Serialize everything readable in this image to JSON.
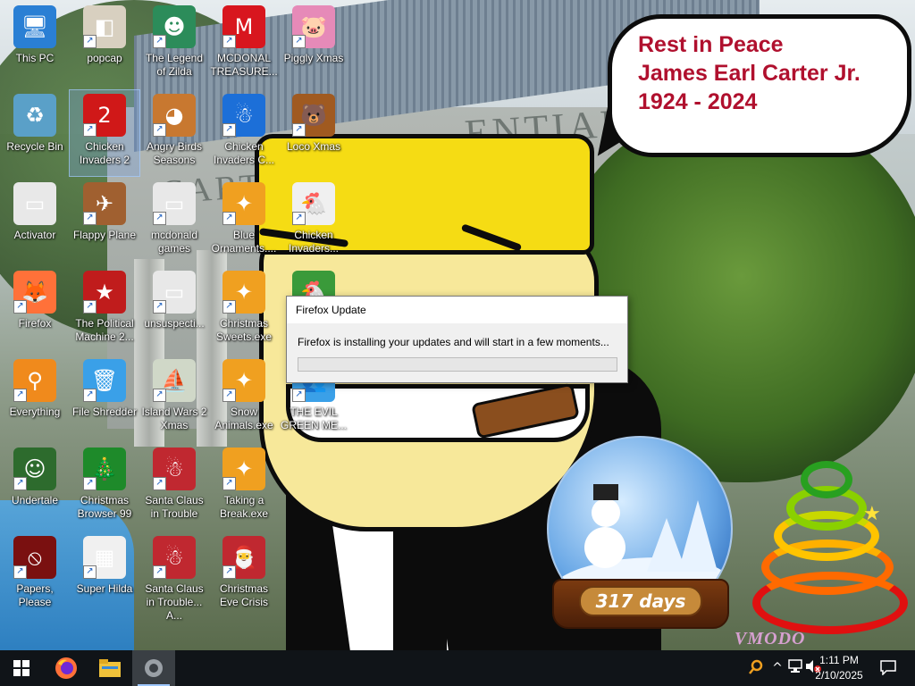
{
  "wallpaper": {
    "building_text": "ENTIAL",
    "building_text2": "CART",
    "speech_bubble": {
      "line1": "Rest in Peace",
      "line2": "James Earl Carter Jr.",
      "line3": "1924 - 2024"
    },
    "snow_globe_days": "317 days",
    "signature": "VMODO"
  },
  "desktop_icons": [
    {
      "label": "This PC",
      "icon": "computer-icon",
      "color": "#2a7fd4",
      "glyph": "🖥"
    },
    {
      "label": "Recycle Bin",
      "icon": "recycle-bin-icon",
      "color": "#5aa0c8",
      "glyph": "♻"
    },
    {
      "label": "Activator",
      "icon": "activator-icon",
      "color": "#e8e8e8",
      "glyph": "▭"
    },
    {
      "label": "Firefox",
      "icon": "firefox-icon",
      "color": "#ff7139",
      "glyph": "🦊"
    },
    {
      "label": "Everything",
      "icon": "everything-icon",
      "color": "#f08a1c",
      "glyph": "⚲"
    },
    {
      "label": "Undertale",
      "icon": "undertale-icon",
      "color": "#2d6b2d",
      "glyph": "☺"
    },
    {
      "label": "Papers, Please",
      "icon": "papers-please-icon",
      "color": "#7a1010",
      "glyph": "⦸"
    },
    {
      "label": "popcap",
      "icon": "popcap-icon",
      "color": "#d8d0c0",
      "glyph": "◧"
    },
    {
      "label": "Chicken Invaders 2",
      "icon": "chicken-invaders-2-icon",
      "color": "#d01818",
      "glyph": "2"
    },
    {
      "label": "Flappy Plane",
      "icon": "flappy-plane-icon",
      "color": "#a06030",
      "glyph": "✈"
    },
    {
      "label": "The Political Machine 2...",
      "icon": "political-machine-icon",
      "color": "#c01c1c",
      "glyph": "★"
    },
    {
      "label": "File Shredder",
      "icon": "file-shredder-icon",
      "color": "#3aa0e8",
      "glyph": "🗑"
    },
    {
      "label": "Christmas Browser 99",
      "icon": "christmas-browser-icon",
      "color": "#1e8a2a",
      "glyph": "🎄"
    },
    {
      "label": "Super Hilda",
      "icon": "super-hilda-icon",
      "color": "#f0f0f0",
      "glyph": "▦"
    },
    {
      "label": "The Legend of Zilda",
      "icon": "legend-of-zilda-icon",
      "color": "#2c8c5a",
      "glyph": "☻"
    },
    {
      "label": "Angry Birds Seasons",
      "icon": "angry-birds-seasons-icon",
      "color": "#c87830",
      "glyph": "◕"
    },
    {
      "label": "mcdonald games",
      "icon": "mcdonald-games-icon",
      "color": "#e8e8e8",
      "glyph": "▭"
    },
    {
      "label": "unsuspecti...",
      "icon": "unsuspecting-icon",
      "color": "#e8e8e8",
      "glyph": "▭"
    },
    {
      "label": "Island Wars 2 Xmas",
      "icon": "island-wars-icon",
      "color": "#d0d8c8",
      "glyph": "⛵"
    },
    {
      "label": "Santa Claus in Trouble",
      "icon": "santa-claus-trouble-icon",
      "color": "#c02830",
      "glyph": "☃"
    },
    {
      "label": "Santa Claus in Trouble... A...",
      "icon": "santa-claus-trouble-2-icon",
      "color": "#c02830",
      "glyph": "☃"
    },
    {
      "label": "MCDONAL TREASURE...",
      "icon": "mcdonald-treasure-icon",
      "color": "#d8161e",
      "glyph": "M"
    },
    {
      "label": "Chicken Invaders C...",
      "icon": "chicken-invaders-c-icon",
      "color": "#1c6fd8",
      "glyph": "☃"
    },
    {
      "label": "Blue Ornaments....",
      "icon": "blue-ornaments-icon",
      "color": "#f0a020",
      "glyph": "✦"
    },
    {
      "label": "Christmas Sweets.exe",
      "icon": "christmas-sweets-icon",
      "color": "#f0a020",
      "glyph": "✦"
    },
    {
      "label": "Snow Animals.exe",
      "icon": "snow-animals-icon",
      "color": "#f0a020",
      "glyph": "✦"
    },
    {
      "label": "Taking a Break.exe",
      "icon": "taking-a-break-icon",
      "color": "#f0a020",
      "glyph": "✦"
    },
    {
      "label": "Christmas Eve Crisis",
      "icon": "christmas-eve-crisis-icon",
      "color": "#c02830",
      "glyph": "🎅"
    },
    {
      "label": "Piggly Xmas",
      "icon": "piggly-xmas-icon",
      "color": "#e68ab8",
      "glyph": "🐷"
    },
    {
      "label": "Loco Xmas",
      "icon": "loco-xmas-icon",
      "color": "#a05a20",
      "glyph": "🐻"
    },
    {
      "label": "Chicken Invaders...",
      "icon": "chicken-invaders-xmas-icon",
      "color": "#f0f0f0",
      "glyph": "🐔"
    },
    {
      "label": "Chicken Invaders...",
      "icon": "chicken-invaders-4-icon",
      "color": "#3a9a3a",
      "glyph": "🐔"
    },
    {
      "label": "THE EVIL GREEN ME...",
      "icon": "evil-green-icon",
      "color": "#3aa0e8",
      "glyph": "👥"
    }
  ],
  "dialog": {
    "title": "Firefox Update",
    "message": "Firefox is installing your updates and will start in a few moments...",
    "progress": 0.0
  },
  "taskbar": {
    "start_icon": "windows-start-icon",
    "pinned": [
      {
        "icon": "firefox-icon"
      },
      {
        "icon": "file-explorer-icon"
      },
      {
        "icon": "firefox-update-icon"
      }
    ],
    "clock_time": "1:11 PM",
    "clock_date": "2/10/2025"
  }
}
